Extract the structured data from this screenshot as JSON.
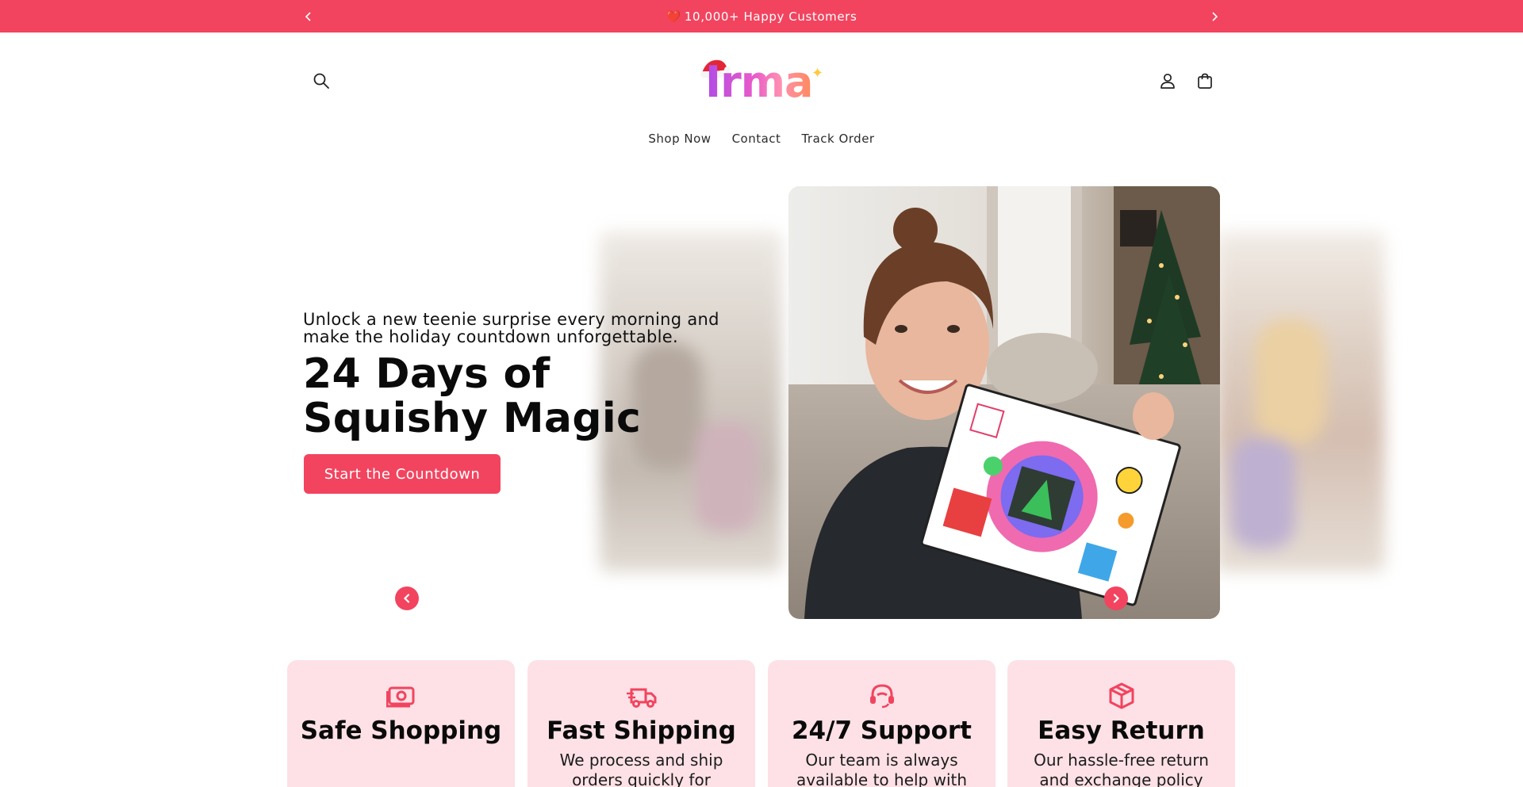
{
  "announcement": {
    "heart": "❤️",
    "text": "10,000+ Happy Customers",
    "prev_icon": "chevron-left-icon",
    "next_icon": "chevron-right-icon"
  },
  "header": {
    "logo_text": "Irma",
    "search_icon": "search-icon",
    "account_icon": "user-icon",
    "cart_icon": "bag-icon"
  },
  "nav": {
    "items": [
      {
        "label": "Shop Now"
      },
      {
        "label": "Contact"
      },
      {
        "label": "Track Order"
      }
    ]
  },
  "hero": {
    "subtitle": "Unlock a new teenie surprise every morning and make the holiday countdown unforgettable.",
    "title": "24 Days of Squishy Magic",
    "cta_label": "Start the Countdown",
    "prev_icon": "chevron-left-icon",
    "next_icon": "chevron-right-icon"
  },
  "features": [
    {
      "icon": "money-icon",
      "title": "Safe Shopping",
      "desc": ""
    },
    {
      "icon": "truck-icon",
      "title": "Fast Shipping",
      "desc": "We process and ship orders quickly for"
    },
    {
      "icon": "headset-icon",
      "title": "24/7 Support",
      "desc": "Our team is always available to help with"
    },
    {
      "icon": "box-icon",
      "title": "Easy Return",
      "desc": "Our hassle-free return and exchange policy"
    }
  ],
  "colors": {
    "accent": "#f2445f",
    "feature_bg": "#fde1e6",
    "text": "#0a0a0a"
  }
}
